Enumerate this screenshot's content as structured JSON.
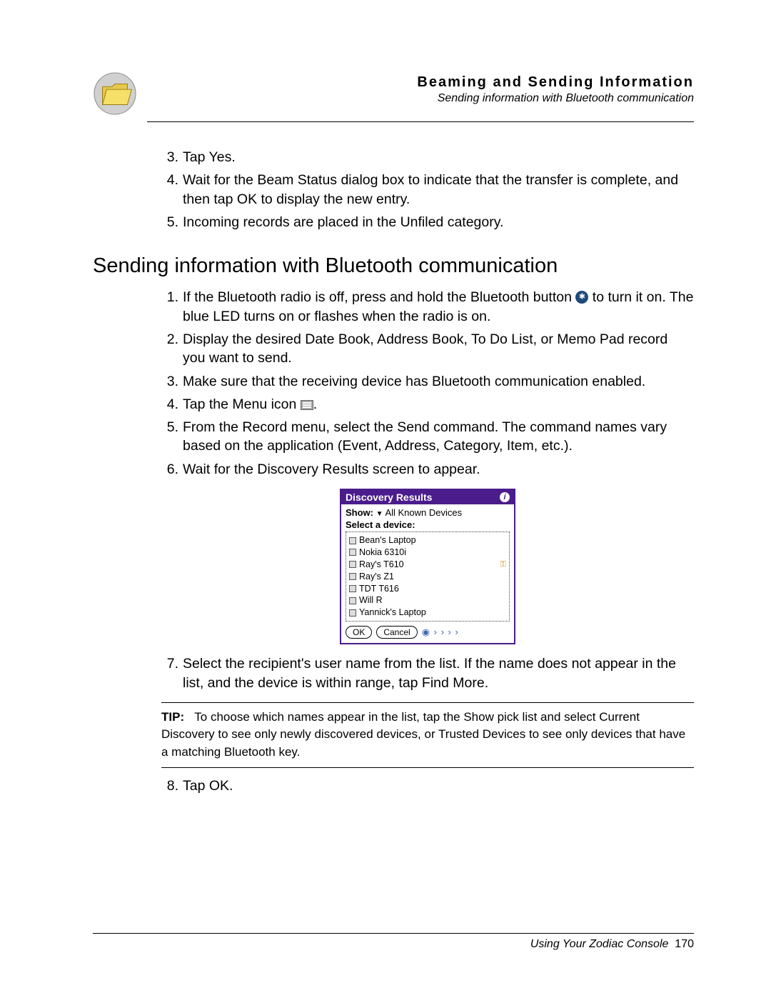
{
  "header": {
    "title": "Beaming and Sending Information",
    "subtitle": "Sending information with Bluetooth communication"
  },
  "list_a": {
    "i3": {
      "num": "3.",
      "text": "Tap Yes."
    },
    "i4": {
      "num": "4.",
      "text": "Wait for the Beam Status dialog box to indicate that the transfer is complete, and then tap OK to display the new entry."
    },
    "i5": {
      "num": "5.",
      "text": "Incoming records are placed in the Unfiled category."
    }
  },
  "section_heading": "Sending information with Bluetooth communication",
  "list_b": {
    "i1": {
      "num": "1.",
      "pre": "If the Bluetooth radio is off, press and hold the Bluetooth button ",
      "post": " to turn it on. The blue LED turns on or flashes when the radio is on."
    },
    "i2": {
      "num": "2.",
      "text": "Display the desired Date Book, Address Book, To Do List, or Memo Pad record you want to send."
    },
    "i3": {
      "num": "3.",
      "text": "Make sure that the receiving device has Bluetooth communication enabled."
    },
    "i4": {
      "num": "4.",
      "pre": "Tap the Menu icon ",
      "post": "."
    },
    "i5": {
      "num": "5.",
      "text": "From the Record menu, select the Send command. The command names vary based on the application (Event, Address, Category, Item, etc.)."
    },
    "i6": {
      "num": "6.",
      "text": "Wait for the Discovery Results screen to appear."
    },
    "i7": {
      "num": "7.",
      "text": "Select the recipient's user name from the list. If the name does not appear in the list, and the device is within range, tap Find More."
    },
    "i8": {
      "num": "8.",
      "text": "Tap OK."
    }
  },
  "discovery": {
    "title": "Discovery Results",
    "show_label": "Show:",
    "show_value": "All Known Devices",
    "select_label": "Select a device:",
    "devices": {
      "d0": "Bean's Laptop",
      "d1": "Nokia 6310i",
      "d2": "Ray's T610",
      "d3": "Ray's Z1",
      "d4": "TDT T616",
      "d5": "Will R",
      "d6": "Yannick's Laptop"
    },
    "ok": "OK",
    "cancel": "Cancel"
  },
  "tip": {
    "label": "TIP:",
    "text": "To choose which names appear in the list, tap the Show pick list and select Current Discovery to see only newly discovered devices, or Trusted Devices to see only devices that have a matching Bluetooth key."
  },
  "footer": {
    "text": "Using Your Zodiac Console",
    "page": "170"
  }
}
